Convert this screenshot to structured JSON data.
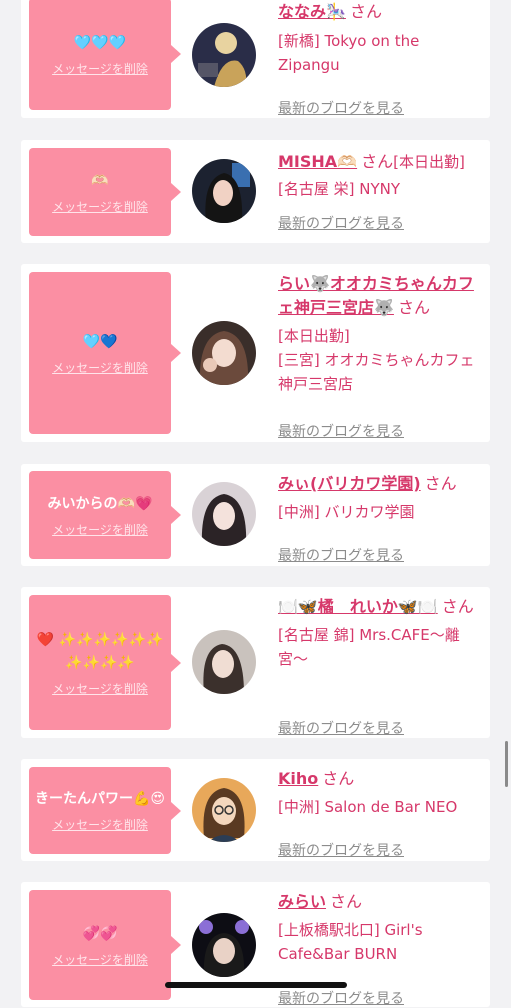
{
  "common": {
    "san": "さん",
    "delete_label": "メッセージを削除",
    "blog_label": "最新のブログを見る"
  },
  "messages": [
    {
      "message": "🩵🩵🩵",
      "name": "ななみ🎠",
      "lines": [
        "[新橋] Tokyo on the Zipangu"
      ]
    },
    {
      "message": "🫶🏻",
      "name": "MISHA🫶🏻",
      "after_san": "[本日出勤]",
      "lines": [
        "[名古屋 栄] NYNY"
      ]
    },
    {
      "message": "🩵💙",
      "name": "らい🐺オオカミちゃんカフェ神戸三宮店🐺",
      "lines": [
        "[本日出勤]",
        "[三宮] オオカミちゃんカフェ神戸三宮店"
      ]
    },
    {
      "message": "みいからの🫶🏻💗",
      "name": "みぃ(バリカワ学園)",
      "lines": [
        "[中洲] バリカワ学園"
      ]
    },
    {
      "message": "❤️ ✨✨✨✨✨✨✨✨✨✨",
      "name": "🍽️🦋橘　れいか🦋🍽️",
      "lines": [
        "[名古屋 錦] Mrs.CAFE〜離宮〜"
      ]
    },
    {
      "message": "きーたんパワー💪😍",
      "name": "Kiho",
      "lines": [
        "[中洲] Salon de Bar NEO"
      ]
    },
    {
      "message": "💞💞",
      "name": "みらい",
      "lines": [
        "[上板橋駅北口] Girl's Cafe&Bar BURN"
      ]
    }
  ]
}
